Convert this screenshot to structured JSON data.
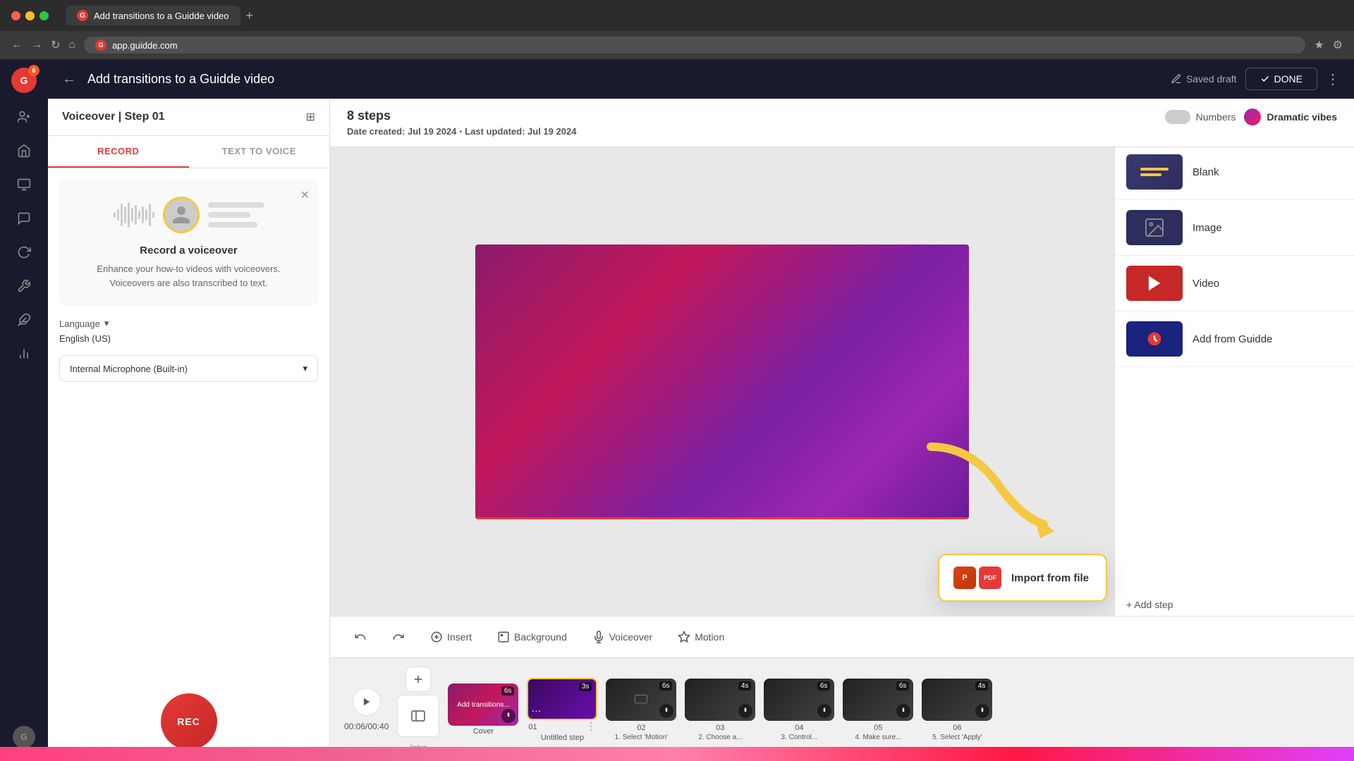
{
  "browser": {
    "tab_title": "Add transitions to a Guidde video",
    "tab_favicon": "G",
    "new_tab_label": "+",
    "address": "app.guidde.com",
    "address_favicon": "G"
  },
  "topbar": {
    "back_label": "←",
    "title": "Add transitions to a Guidde video",
    "saved_draft_label": "Saved draft",
    "done_label": "DONE",
    "more_label": "⋮"
  },
  "left_panel": {
    "header_title": "Voiceover | Step 01",
    "header_icon": "⊞",
    "tab_record": "RECORD",
    "tab_tts": "TEXT TO VOICE",
    "card_title": "Record a voiceover",
    "card_desc1": "Enhance your how-to videos with voiceovers.",
    "card_desc2": "Voiceovers are also transcribed to text.",
    "language_label": "Language",
    "language_value": "English (US)",
    "microphone_label": "Internal Microphone (Built-in)",
    "rec_label": "REC"
  },
  "content_header": {
    "steps_count": "8 steps",
    "date_created_label": "Date created:",
    "date_created": "Jul 19 2024",
    "last_updated_label": "Last updated:",
    "last_updated": "Jul 19 2024",
    "numbers_label": "Numbers",
    "dramatic_vibes_label": "Dramatic vibes"
  },
  "toolbar": {
    "undo_label": "↩",
    "redo_label": "↪",
    "insert_label": "Insert",
    "background_label": "Background",
    "voiceover_label": "Voiceover",
    "motion_label": "Motion"
  },
  "timeline": {
    "time_display": "00:06/00:40",
    "intro_label": "Intro",
    "clips": [
      {
        "label": "Cover",
        "sublabel": "",
        "number": "",
        "duration": "6s",
        "type": "cover",
        "selected": false
      },
      {
        "label": "Untitled step",
        "sublabel": "",
        "number": "01",
        "duration": "3s",
        "type": "dark",
        "selected": true
      },
      {
        "label": "1. Select 'Motion'",
        "sublabel": "",
        "number": "02",
        "duration": "6s",
        "type": "screen",
        "selected": false
      },
      {
        "label": "2. Choose a...",
        "sublabel": "",
        "number": "03",
        "duration": "4s",
        "type": "screen",
        "selected": false
      },
      {
        "label": "3. Control...",
        "sublabel": "",
        "number": "04",
        "duration": "6s",
        "type": "screen",
        "selected": false
      },
      {
        "label": "4. Make sure...",
        "sublabel": "",
        "number": "05",
        "duration": "6s",
        "type": "screen",
        "selected": false
      },
      {
        "label": "5. Select 'Apply'",
        "sublabel": "",
        "number": "06",
        "duration": "4s",
        "type": "screen",
        "selected": false
      }
    ],
    "add_step_label": "+ Add step"
  },
  "right_panel": {
    "templates": [
      {
        "name": "Blank",
        "type": "blank"
      },
      {
        "name": "Image",
        "type": "image"
      },
      {
        "name": "Video",
        "type": "video"
      },
      {
        "name": "Add from Guidde",
        "type": "guidde"
      }
    ],
    "add_step_label": "+ Add step"
  },
  "import_popup": {
    "label": "Import from file",
    "ppt_label": "P",
    "pdf_label": "PDF"
  }
}
